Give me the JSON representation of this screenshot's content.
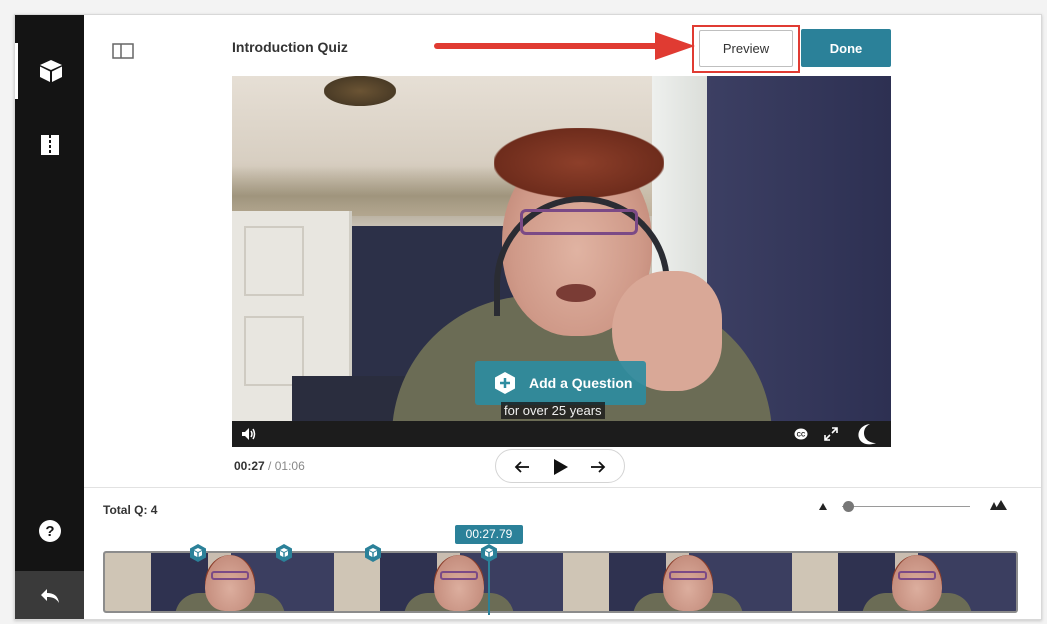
{
  "header": {
    "title": "Introduction Quiz",
    "preview_label": "Preview",
    "done_label": "Done"
  },
  "video": {
    "overlay_button": "Add a Question",
    "caption": "for over 25 years",
    "controls": [
      "volume-icon",
      "closed-captions-icon",
      "fullscreen-icon",
      "kaltura-logo-icon"
    ]
  },
  "playback": {
    "current": "00:27",
    "separator": "/",
    "duration": "01:06"
  },
  "timeline": {
    "total_questions": "Total Q: 4",
    "playhead_time": "00:27.79",
    "question_count": 4,
    "zoom_level": 0.05
  },
  "sidebar": {
    "items": [
      "quiz-cube-icon",
      "chapters-icon",
      "help-icon",
      "back-icon"
    ]
  },
  "colors": {
    "accent": "#2b8199",
    "sidebar": "#141414",
    "highlight": "#e03b32"
  }
}
